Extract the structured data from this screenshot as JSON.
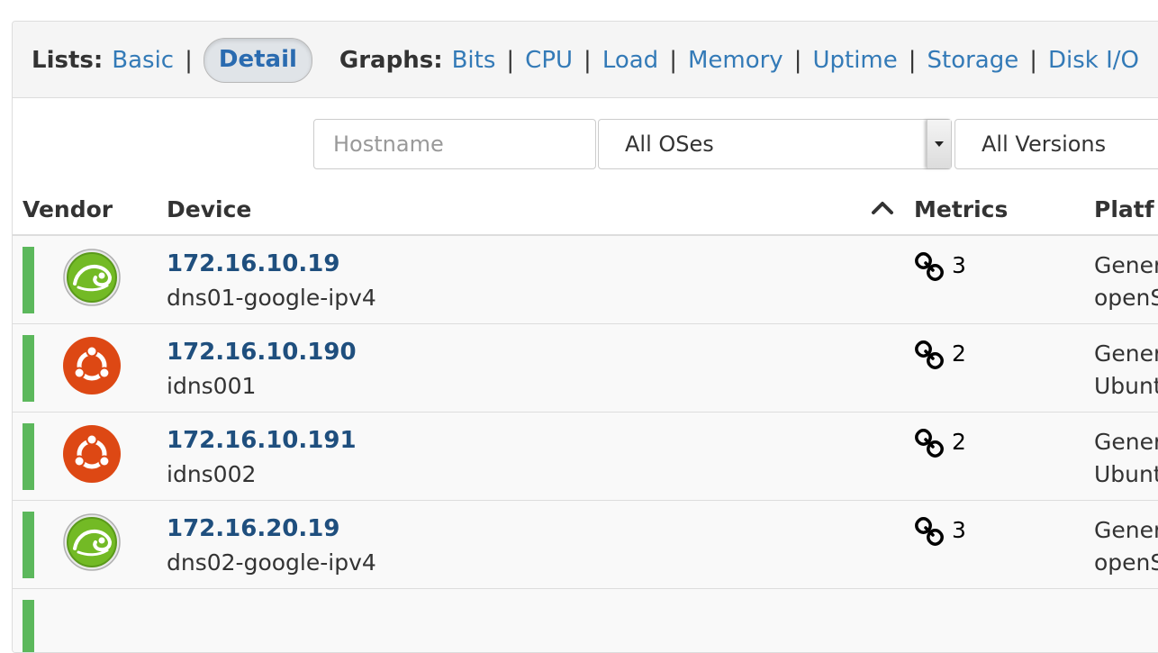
{
  "nav": {
    "lists_label": "Lists:",
    "lists": [
      {
        "label": "Basic",
        "active": false
      },
      {
        "label": "Detail",
        "active": true
      }
    ],
    "graphs_label": "Graphs:",
    "graphs": [
      "Bits",
      "CPU",
      "Load",
      "Memory",
      "Uptime",
      "Storage",
      "Disk I/O"
    ],
    "separator": "|"
  },
  "filters": {
    "hostname_placeholder": "Hostname",
    "os_select_value": "All OSes",
    "version_select_value": "All Versions"
  },
  "table": {
    "headers": {
      "vendor": "Vendor",
      "device": "Device",
      "metrics": "Metrics",
      "platform": "Platf"
    },
    "sort": "ascending",
    "rows": [
      {
        "status": "up",
        "vendor_icon": "opensuse-logo",
        "ip": "172.16.10.19",
        "hostname": "dns01-google-ipv4",
        "metrics": "3",
        "platform_line1": "Gener",
        "platform_line2": "openS"
      },
      {
        "status": "up",
        "vendor_icon": "ubuntu-logo",
        "ip": "172.16.10.190",
        "hostname": "idns001",
        "metrics": "2",
        "platform_line1": "Gener",
        "platform_line2": "Ubunt"
      },
      {
        "status": "up",
        "vendor_icon": "ubuntu-logo",
        "ip": "172.16.10.191",
        "hostname": "idns002",
        "metrics": "2",
        "platform_line1": "Gener",
        "platform_line2": "Ubunt"
      },
      {
        "status": "up",
        "vendor_icon": "opensuse-logo",
        "ip": "172.16.20.19",
        "hostname": "dns02-google-ipv4",
        "metrics": "3",
        "platform_line1": "Gener",
        "platform_line2": "openS"
      }
    ]
  },
  "colors": {
    "status_up": "#5cb85c",
    "link": "#337ab7",
    "device_link": "#1f4f7e",
    "ubuntu": "#dd4814",
    "opensuse": "#73ba25"
  }
}
